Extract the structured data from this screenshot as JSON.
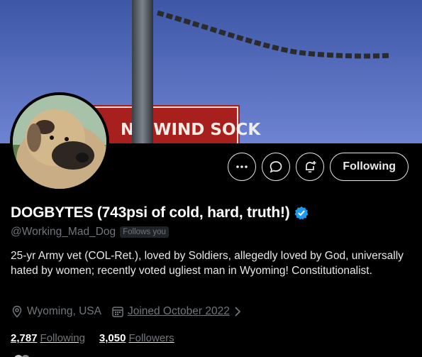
{
  "banner": {
    "sign_text": "NG WIND SOCK",
    "sign_color": "#b22222"
  },
  "profile": {
    "display_name": "DOGBYTES (743psi of cold, hard, truth!)",
    "handle": "@Working_Mad_Dog",
    "follows_you": "Follows you",
    "bio": "25-yr Army vet (COL-Ret.), loved by Soldiers, allegedly loved by God, universally hated by women; recently voted ugliest man in Wyoming! Constitutionalist.",
    "location": "Wyoming, USA",
    "joined": "Joined October 2022",
    "following_count": "2,787",
    "following_label": "Following",
    "followers_count": "3,050",
    "followers_label": "Followers",
    "verified_color": "#1d9bf0"
  },
  "actions": {
    "more_icon": "more-icon",
    "message_icon": "message-icon",
    "notify_icon": "bell-plus-icon",
    "follow_label": "Following"
  }
}
